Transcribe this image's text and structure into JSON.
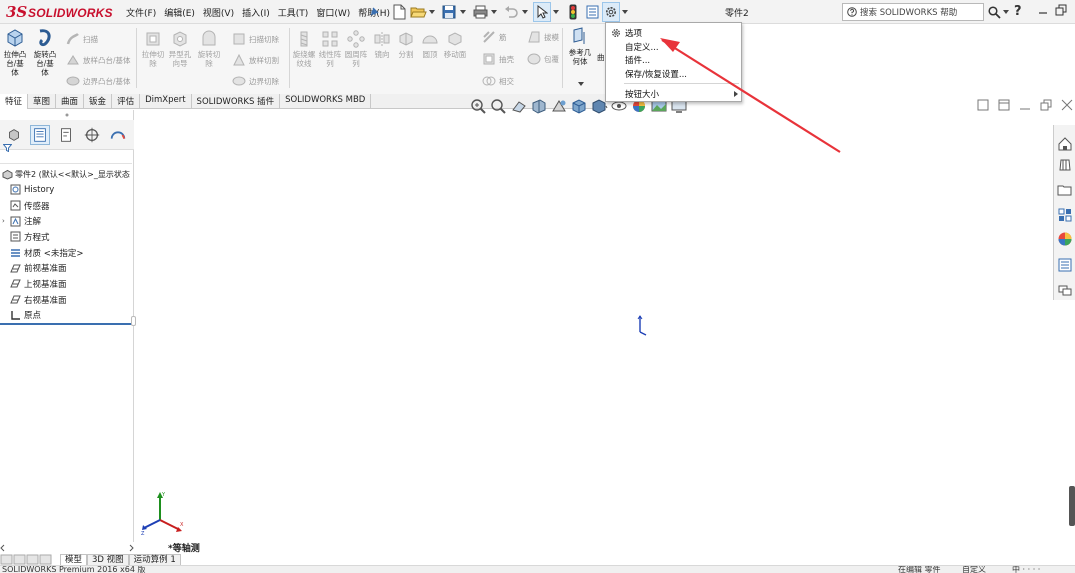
{
  "app": {
    "logo_prefix": "3S",
    "logo_text": "SOLIDWORKS",
    "document_title": "零件2"
  },
  "menu": [
    "文件(F)",
    "编辑(E)",
    "视图(V)",
    "插入(I)",
    "工具(T)",
    "窗口(W)",
    "帮助(H)"
  ],
  "search": {
    "placeholder": "搜索 SOLIDWORKS 帮助"
  },
  "help_label": "?",
  "command_manager": {
    "big_buttons": [
      {
        "label": "拉伸凸\n台/基\n体",
        "icon": "extrude-boss-icon"
      },
      {
        "label": "旋转凸\n台/基\n体",
        "icon": "revolve-boss-icon"
      }
    ],
    "small_buttons": [
      {
        "label": "扫描",
        "icon": "sweep-icon"
      },
      {
        "label": "放样凸台/基体",
        "icon": "loft-icon"
      },
      {
        "label": "边界凸台/基体",
        "icon": "boundary-boss-icon"
      }
    ],
    "cut_buttons": [
      {
        "label": "拉伸切\n除",
        "icon": "extrude-cut-icon"
      },
      {
        "label": "异型孔\n向导",
        "icon": "hole-wizard-icon"
      },
      {
        "label": "旋转切\n除",
        "icon": "revolve-cut-icon"
      }
    ],
    "cut_small_buttons": [
      {
        "label": "扫描切除",
        "icon": "swept-cut-icon"
      },
      {
        "label": "放样切割",
        "icon": "lofted-cut-icon"
      },
      {
        "label": "边界切除",
        "icon": "boundary-cut-icon"
      }
    ],
    "feature_buttons": [
      {
        "label": "旋绕螺\n纹线",
        "icon": "thread-icon"
      },
      {
        "label": "线性阵\n列",
        "icon": "linear-pattern-icon"
      },
      {
        "label": "圆周阵\n列",
        "icon": "circular-pattern-icon"
      },
      {
        "label": "镜向",
        "icon": "mirror-icon"
      },
      {
        "label": "分割",
        "icon": "split-icon"
      },
      {
        "label": "圆顶",
        "icon": "dome-icon"
      },
      {
        "label": "移动面",
        "icon": "move-face-icon"
      }
    ],
    "feature_small_buttons": [
      {
        "label": "筋",
        "icon": "rib-icon"
      },
      {
        "label": "拔模",
        "icon": "draft-icon"
      },
      {
        "label": "抽壳",
        "icon": "shell-icon"
      },
      {
        "label": "包覆",
        "icon": "wrap-icon"
      },
      {
        "label": "相交",
        "icon": "intersect-icon"
      }
    ],
    "reference_geometry": "参考几\n何体",
    "ref_extra": "曲"
  },
  "tabs": [
    {
      "label": "特征",
      "active": true
    },
    {
      "label": "草图"
    },
    {
      "label": "曲面"
    },
    {
      "label": "钣金"
    },
    {
      "label": "评估"
    },
    {
      "label": "DimXpert"
    },
    {
      "label": "SOLIDWORKS 插件"
    },
    {
      "label": "SOLIDWORKS MBD"
    }
  ],
  "dropdown": {
    "items": [
      "选项",
      "自定义...",
      "插件...",
      "保存/恢复设置...",
      "按钮大小"
    ]
  },
  "feature_tree": {
    "root": "零件2 (默认<<默认>_显示状态",
    "nodes": [
      {
        "label": "History",
        "icon": "history-icon"
      },
      {
        "label": "传感器",
        "icon": "sensor-icon"
      },
      {
        "label": "注解",
        "icon": "annotation-icon",
        "expandable": true
      },
      {
        "label": "方程式",
        "icon": "equation-icon"
      },
      {
        "label": "材质 <未指定>",
        "icon": "material-icon"
      },
      {
        "label": "前视基准面",
        "icon": "plane-icon"
      },
      {
        "label": "上视基准面",
        "icon": "plane-icon"
      },
      {
        "label": "右视基准面",
        "icon": "plane-icon"
      },
      {
        "label": "原点",
        "icon": "origin-icon"
      }
    ]
  },
  "view_label": "*等轴测",
  "bottom_tabs": [
    "模型",
    "3D 视图",
    "运动算例 1"
  ],
  "status": {
    "version": "SOLIDWORKS Premium 2016 x64 版",
    "mode": "在编辑 零件",
    "units": "自定义",
    "ime": "中 ·  ·  ·  ·"
  },
  "colors": {
    "brand": "#c8102e",
    "arrow": "#e8333a",
    "tree_end_bar": "#3a6fb0"
  }
}
